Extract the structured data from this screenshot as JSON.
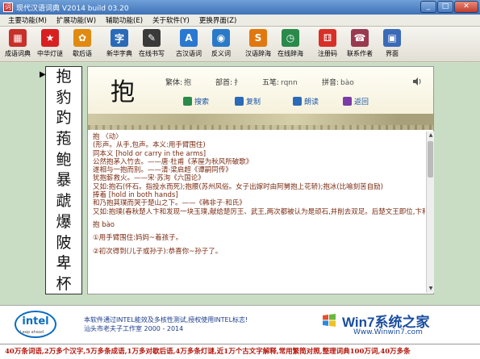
{
  "window": {
    "title": "现代汉语词典 V2014 build 03.20"
  },
  "menu": [
    "主要功能(M)",
    "扩展功能(W)",
    "辅助功能(E)",
    "关于软件(Y)",
    "更换界面(Z)"
  ],
  "toolbar": [
    {
      "label": "成语词典",
      "icon": "grid-icon",
      "color": "#c8302a",
      "glyph": "▦"
    },
    {
      "label": "中华灯谜",
      "icon": "star-icon",
      "color": "#d82020",
      "glyph": "★"
    },
    {
      "label": "歇后语",
      "icon": "flower-icon",
      "color": "#e08a10",
      "glyph": "✿"
    },
    {
      "label": "新华字典",
      "icon": "book-icon",
      "color": "#2a6ab8",
      "glyph": "字"
    },
    {
      "label": "在线书写",
      "icon": "pen-icon",
      "color": "#3a3a3a",
      "glyph": "✎"
    },
    {
      "label": "古汉语词",
      "icon": "a-circle-icon",
      "color": "#2a78d0",
      "glyph": "A"
    },
    {
      "label": "反义词",
      "icon": "globe-icon",
      "color": "#2a7ac8",
      "glyph": "◉"
    },
    {
      "label": "汉语辞海",
      "icon": "s-icon",
      "color": "#e07810",
      "glyph": "S"
    },
    {
      "label": "在线辞海",
      "icon": "clock-icon",
      "color": "#2a8a4a",
      "glyph": "◷"
    },
    {
      "label": "注册码",
      "icon": "dice-icon",
      "color": "#d83028",
      "glyph": "⚅"
    },
    {
      "label": "联系作者",
      "icon": "contact-icon",
      "color": "#9a3a50",
      "glyph": "☎"
    },
    {
      "label": "界面",
      "icon": "display-icon",
      "color": "#3a6ab8",
      "glyph": "▣"
    }
  ],
  "charlist": [
    "抱",
    "豹",
    "趵",
    "菢",
    "鲍",
    "暴",
    "虣",
    "爆",
    "陂",
    "卑",
    "杯"
  ],
  "entry": {
    "char": "抱",
    "fanti_label": "繁体:",
    "fanti": "抱",
    "bushou_label": "部首:",
    "bushou": "扌",
    "wubi_label": "五笔:",
    "wubi": "rqnn",
    "pinyin_label": "拼音:",
    "pinyin": "bào"
  },
  "actions": {
    "search": "搜索",
    "copy": "复制",
    "read": "朗读",
    "back": "返回"
  },
  "definition": {
    "lines": [
      "抱 〈动〉",
      "(形声。从手,包声。本义:用手臂围住)",
      "同本义 [hold or carry in the arms]",
      "公然抱茅入竹去。——唐·杜甫《茅屋为秋风所破歌》",
      "遂相与一抱而别。——清·梁启超《谭嗣同传》",
      "犹抱薪救火。——宋·苏洵《六国论》",
      "又如:抱石(怀石。指投水而死);抱腰(苏州风俗。女子出嫁时由阿舅抱上花轿);抱冰(比喻刻苦自励)",
      "捧着 [hold in both hands]",
      "和乃抱其璞而哭于楚山之下。——《韩非子·和氏》",
      "又如:抱璞(春秋楚人卞和发现一块玉璞,献给楚厉王、武王,两次都被认为是顽石,并削去双足。后楚文王即位,卞和又抱璞哭于荆山之下,文王命人剖璞"
    ],
    "subhead": "抱 bào",
    "senses": [
      "①用手臂围住:妈妈~着孩子。",
      "②初次得到(儿子或孙子):恭喜你~孙子了。"
    ]
  },
  "footer": {
    "intel_logo": "intel",
    "intel_tagline": "Leap ahead",
    "line1": "本软件通过INTEL能效及多核性测试,授权使用INTEL标志!",
    "line2": "汕头市老夫子工作室 2000 - 2014",
    "watermark_brand": "Win7系统之家",
    "watermark_url": "Www.Winwin7.com"
  },
  "ticker": "40万条词语,2万多个汉字,5万多条成语,1万多对歇后语,4万多条灯谜,近1万个古文字解释,常用繁简对照,整理词典100万词,40万多条"
}
